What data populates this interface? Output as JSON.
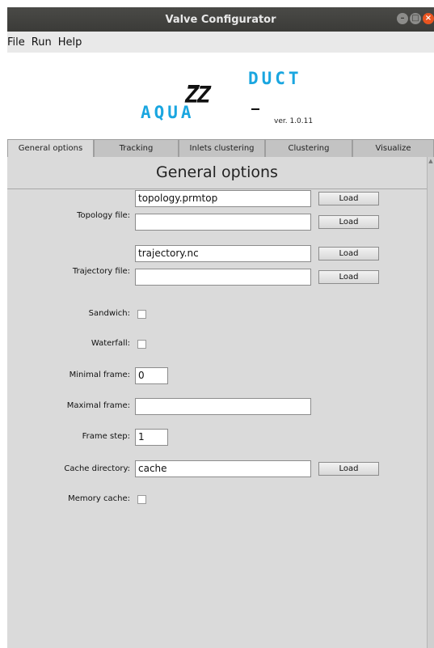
{
  "window": {
    "title": "Valve Configurator"
  },
  "menu": {
    "items": [
      "File",
      "Run",
      "Help"
    ]
  },
  "banner": {
    "logo_left": "AQUA",
    "logo_right": "DUCT",
    "logo_mark": "ZZ",
    "version": "ver. 1.0.11"
  },
  "tabs": [
    "General options",
    "Tracking",
    "Inlets clustering",
    "Clustering",
    "Visualize"
  ],
  "active_tab": "General options",
  "section": {
    "title": "General options"
  },
  "form": {
    "topology": {
      "label": "Topology file:",
      "value1": "topology.prmtop",
      "value2": ""
    },
    "trajectory": {
      "label": "Trajectory file:",
      "value1": "trajectory.nc",
      "value2": ""
    },
    "sandwich": {
      "label": "Sandwich:",
      "checked": false
    },
    "waterfall": {
      "label": "Waterfall:",
      "checked": false
    },
    "minimal_frame": {
      "label": "Minimal frame:",
      "value": "0"
    },
    "maximal_frame": {
      "label": "Maximal frame:",
      "value": ""
    },
    "frame_step": {
      "label": "Frame step:",
      "value": "1"
    },
    "cache_directory": {
      "label": "Cache directory:",
      "value": "cache"
    },
    "memory_cache": {
      "label": "Memory cache:",
      "checked": false
    },
    "load_label": "Load"
  },
  "colors": {
    "accent": "#1aa6e0",
    "titlebar": "#3b3b38",
    "close": "#e95420",
    "panel": "#dadada"
  }
}
